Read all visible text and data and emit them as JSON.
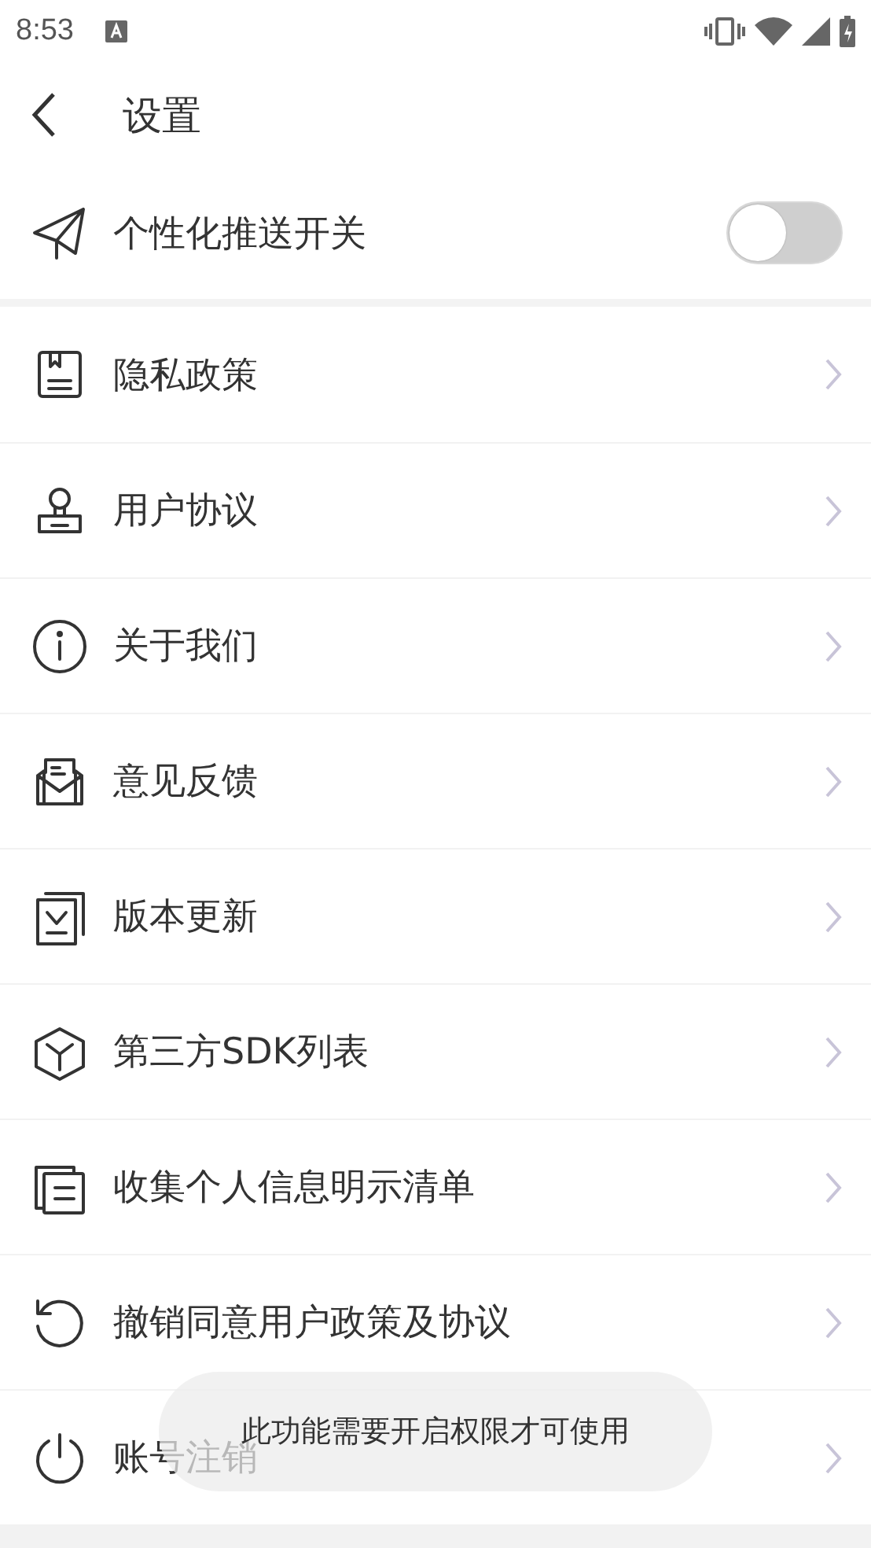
{
  "status_bar": {
    "time": "8:53"
  },
  "header": {
    "title": "设置"
  },
  "push_toggle": {
    "label": "个性化推送开关",
    "on": false
  },
  "menu": [
    {
      "label": "隐私政策"
    },
    {
      "label": "用户协议"
    },
    {
      "label": "关于我们"
    },
    {
      "label": "意见反馈"
    },
    {
      "label": "版本更新"
    },
    {
      "label": "第三方SDK列表"
    },
    {
      "label": "收集个人信息明示清单"
    },
    {
      "label": "撤销同意用户政策及协议"
    },
    {
      "label": "账号注销"
    }
  ],
  "toast": {
    "text": "此功能需要开启权限才可使用"
  }
}
